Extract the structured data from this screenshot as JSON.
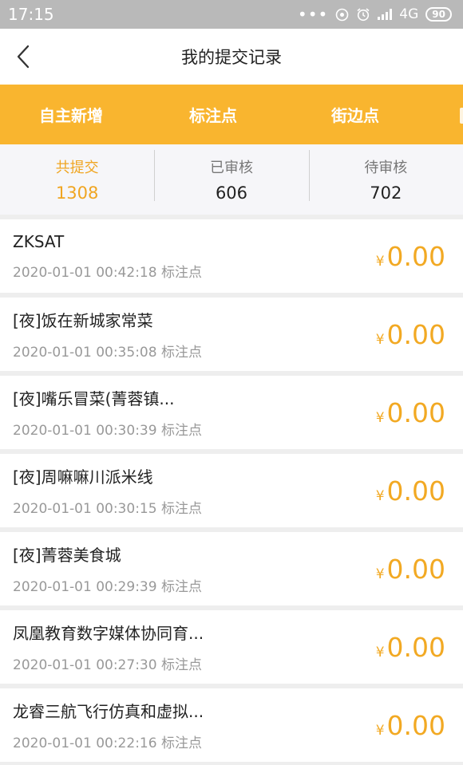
{
  "status_bar": {
    "time": "17:15",
    "network": "4G",
    "battery": "90"
  },
  "header": {
    "title": "我的提交记录"
  },
  "tabs": [
    {
      "label": "自主新增"
    },
    {
      "label": "标注点"
    },
    {
      "label": "街边点"
    }
  ],
  "stats": [
    {
      "label": "共提交",
      "value": "1308"
    },
    {
      "label": "已审核",
      "value": "606"
    },
    {
      "label": "待审核",
      "value": "702"
    }
  ],
  "records": [
    {
      "name": "ZKSAT",
      "datetime": "2020-01-01 00:42:18",
      "type": "标注点",
      "currency": "¥",
      "amount": "0.00"
    },
    {
      "name": "[夜]饭在新城家常菜",
      "datetime": "2020-01-01 00:35:08",
      "type": "标注点",
      "currency": "¥",
      "amount": "0.00"
    },
    {
      "name": "[夜]嘴乐冒菜(菁蓉镇...",
      "datetime": "2020-01-01 00:30:39",
      "type": "标注点",
      "currency": "¥",
      "amount": "0.00"
    },
    {
      "name": "[夜]周嘛嘛川派米线",
      "datetime": "2020-01-01 00:30:15",
      "type": "标注点",
      "currency": "¥",
      "amount": "0.00"
    },
    {
      "name": "[夜]菁蓉美食城",
      "datetime": "2020-01-01 00:29:39",
      "type": "标注点",
      "currency": "¥",
      "amount": "0.00"
    },
    {
      "name": "凤凰教育数字媒体协同育...",
      "datetime": "2020-01-01 00:27:30",
      "type": "标注点",
      "currency": "¥",
      "amount": "0.00"
    },
    {
      "name": "龙睿三航飞行仿真和虚拟...",
      "datetime": "2020-01-01 00:22:16",
      "type": "标注点",
      "currency": "¥",
      "amount": "0.00"
    }
  ],
  "colors": {
    "accent": "#f9b52f",
    "amount": "#f2a923",
    "status_bar": "#b9b9b9"
  }
}
